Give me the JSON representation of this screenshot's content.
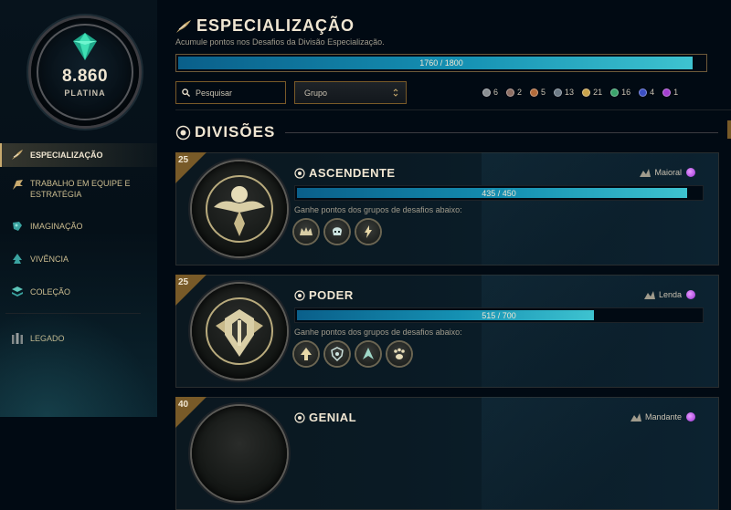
{
  "profile": {
    "score": "8.860",
    "tier": "PLATINA",
    "gem_icon": "platinum-gem-icon"
  },
  "sidebar": {
    "items": [
      {
        "label": "ESPECIALIZAÇÃO",
        "icon": "feather-quill-icon",
        "active": true
      },
      {
        "label": "TRABALHO EM EQUIPE E ESTRATÉGIA",
        "icon": "flag-icon",
        "active": false
      },
      {
        "label": "IMAGINAÇÃO",
        "icon": "paint-icon",
        "active": false
      },
      {
        "label": "VIVÊNCIA",
        "icon": "tree-icon",
        "active": false
      },
      {
        "label": "COLEÇÃO",
        "icon": "stack-icon",
        "active": false
      }
    ],
    "legacy": {
      "label": "LEGADO",
      "icon": "pillars-icon"
    }
  },
  "header": {
    "title": "ESPECIALIZAÇÃO",
    "subtitle": "Acumule pontos nos Desafios da Divisão Especialização.",
    "progress": {
      "current": 1760,
      "max": 1800,
      "text": "1760 / 1800"
    }
  },
  "filters": {
    "search_placeholder": "Pesquisar",
    "group_select": "Grupo",
    "tier_counts": [
      {
        "value": "6",
        "color": "#8a8f93"
      },
      {
        "value": "2",
        "color": "#8d6e63"
      },
      {
        "value": "5",
        "color": "#b36b3a"
      },
      {
        "value": "13",
        "color": "#6c7a86"
      },
      {
        "value": "21",
        "color": "#c9a24a"
      },
      {
        "value": "16",
        "color": "#3aa36b"
      },
      {
        "value": "4",
        "color": "#3b4fc4"
      },
      {
        "value": "1",
        "color": "#a43fd0"
      }
    ]
  },
  "section": {
    "title": "DIVISÕES"
  },
  "divisions": [
    {
      "level": "25",
      "name": "ASCENDENTE",
      "rank": "Maioral",
      "progress": {
        "current": 435,
        "max": 450,
        "text": "435 / 450"
      },
      "hint": "Ganhe pontos dos grupos de desafios abaixo:",
      "groups": [
        "crown-icon",
        "skull-helmet-icon",
        "lightning-icon"
      ]
    },
    {
      "level": "25",
      "name": "PODER",
      "rank": "Lenda",
      "progress": {
        "current": 515,
        "max": 700,
        "text": "515 / 700"
      },
      "hint": "Ganhe pontos dos grupos de desafios abaixo:",
      "groups": [
        "arrow-up-icon",
        "shield-icon",
        "spire-icon",
        "paw-icon"
      ]
    },
    {
      "level": "40",
      "name": "GENIAL",
      "rank": "Mandante",
      "progress": {
        "current": 0,
        "max": 0,
        "text": ""
      },
      "hint": "",
      "groups": []
    }
  ]
}
